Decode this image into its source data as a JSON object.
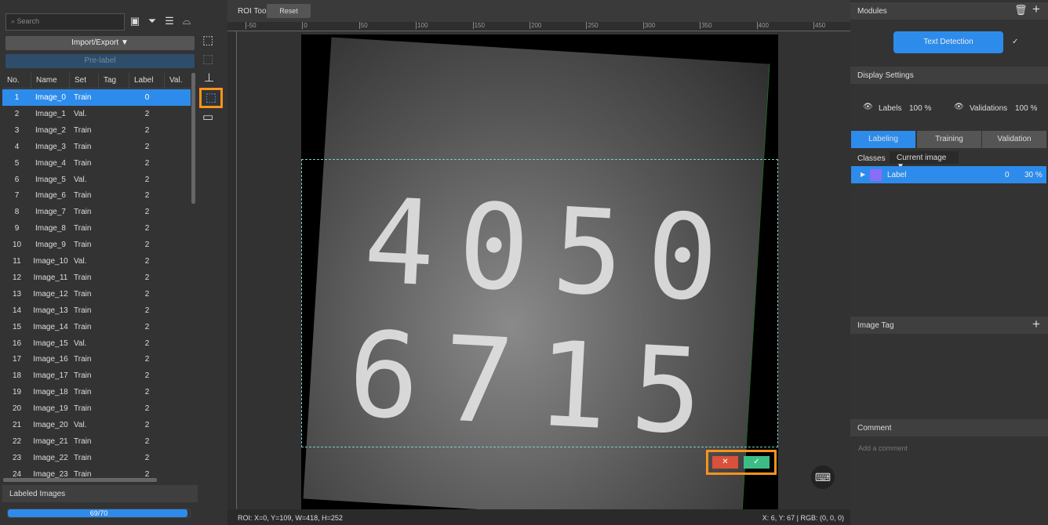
{
  "left": {
    "search_placeholder": "Search",
    "import_export": "Import/Export ▼",
    "prelabel": "Pre-label",
    "columns": [
      "No.",
      "Name",
      "Set",
      "Tag",
      "Label",
      "Val."
    ],
    "rows": [
      [
        "1",
        "Image_0",
        "Train",
        "0"
      ],
      [
        "2",
        "Image_1",
        "Val.",
        "2"
      ],
      [
        "3",
        "Image_2",
        "Train",
        "2"
      ],
      [
        "4",
        "Image_3",
        "Train",
        "2"
      ],
      [
        "5",
        "Image_4",
        "Train",
        "2"
      ],
      [
        "6",
        "Image_5",
        "Val.",
        "2"
      ],
      [
        "7",
        "Image_6",
        "Train",
        "2"
      ],
      [
        "8",
        "Image_7",
        "Train",
        "2"
      ],
      [
        "9",
        "Image_8",
        "Train",
        "2"
      ],
      [
        "10",
        "Image_9",
        "Train",
        "2"
      ],
      [
        "11",
        "Image_10",
        "Val.",
        "2"
      ],
      [
        "12",
        "Image_11",
        "Train",
        "2"
      ],
      [
        "13",
        "Image_12",
        "Train",
        "2"
      ],
      [
        "14",
        "Image_13",
        "Train",
        "2"
      ],
      [
        "15",
        "Image_14",
        "Train",
        "2"
      ],
      [
        "16",
        "Image_15",
        "Val.",
        "2"
      ],
      [
        "17",
        "Image_16",
        "Train",
        "2"
      ],
      [
        "18",
        "Image_17",
        "Train",
        "2"
      ],
      [
        "19",
        "Image_18",
        "Train",
        "2"
      ],
      [
        "20",
        "Image_19",
        "Train",
        "2"
      ],
      [
        "21",
        "Image_20",
        "Val.",
        "2"
      ],
      [
        "22",
        "Image_21",
        "Train",
        "2"
      ],
      [
        "23",
        "Image_22",
        "Train",
        "2"
      ],
      [
        "24",
        "Image_23",
        "Train",
        "2"
      ]
    ],
    "labeled_title": "Labeled Images",
    "labeled_text": "69/70",
    "labeled_fraction": 0.986
  },
  "canvas": {
    "tool_label": "ROI Tool",
    "reset": "Reset",
    "ruler_x": [
      "-50",
      "0",
      "50",
      "100",
      "150",
      "200",
      "250",
      "300",
      "350",
      "400",
      "450"
    ],
    "digits_top": "4050",
    "digits_bottom": "6715",
    "roi_status": "ROI: X=0, Y=109, W=418, H=252",
    "cursor_status": "X: 6, Y: 67 | RGB: (0, 0, 0)",
    "cancel": "✕",
    "confirm": "✓"
  },
  "right": {
    "modules_title": "Modules",
    "module_name": "Text Detection",
    "display_settings": "Display Settings",
    "labels": "Labels",
    "labels_pct": "100 %",
    "validations": "Validations",
    "validations_pct": "100 %",
    "tabs": [
      "Labeling",
      "Training",
      "Validation"
    ],
    "classes": "Classes",
    "class_filter": "Current image ▼",
    "class_row": {
      "name": "Label",
      "count": "0",
      "pct": "30 %",
      "color": "#8b6cf6"
    },
    "image_tag": "Image Tag",
    "comment": "Comment",
    "comment_placeholder": "Add a comment"
  },
  "colors": {
    "accent": "#2d8ceb",
    "cancel": "#d9503b",
    "confirm": "#3dbd86",
    "highlight": "#f7931e"
  }
}
